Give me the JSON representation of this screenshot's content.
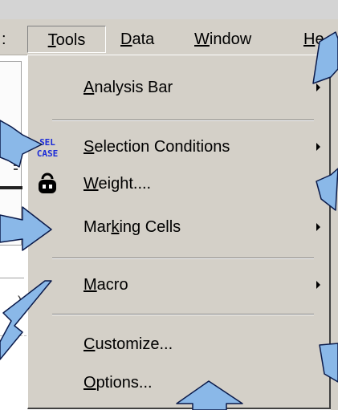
{
  "menubar": {
    "sep_label": ":",
    "items": [
      {
        "pre": "",
        "key": "T",
        "post": "ools"
      },
      {
        "pre": "",
        "key": "D",
        "post": "ata"
      },
      {
        "pre": "",
        "key": "W",
        "post": "indow"
      },
      {
        "pre": "",
        "key": "H",
        "post": "e"
      }
    ]
  },
  "icons": {
    "selection": "sel-case-icon",
    "weight": "weight-icon"
  },
  "sel_case_text": {
    "line1": "SEL",
    "line2": "CASE"
  },
  "left_text": ")",
  "tools_menu": {
    "items": [
      {
        "pre": "",
        "key": "A",
        "post": "nalysis Bar",
        "submenu": true
      },
      {
        "pre": "",
        "key": "S",
        "post": "election Conditions",
        "submenu": true
      },
      {
        "pre": "",
        "key": "W",
        "post": "eight....",
        "submenu": false
      },
      {
        "pre": "Mar",
        "key": "k",
        "post": "ing Cells",
        "submenu": true
      },
      {
        "pre": "",
        "key": "M",
        "post": "acro",
        "submenu": true
      },
      {
        "pre": "",
        "key": "C",
        "post": "ustomize...",
        "submenu": false
      },
      {
        "pre": "",
        "key": "O",
        "post": "ptions...",
        "submenu": false
      }
    ]
  },
  "colors": {
    "menu_bg": "#d4d0c8",
    "callout_fill": "#8ab8e8",
    "callout_stroke": "#0a1a4a",
    "icon_blue": "#1a2ad8"
  }
}
